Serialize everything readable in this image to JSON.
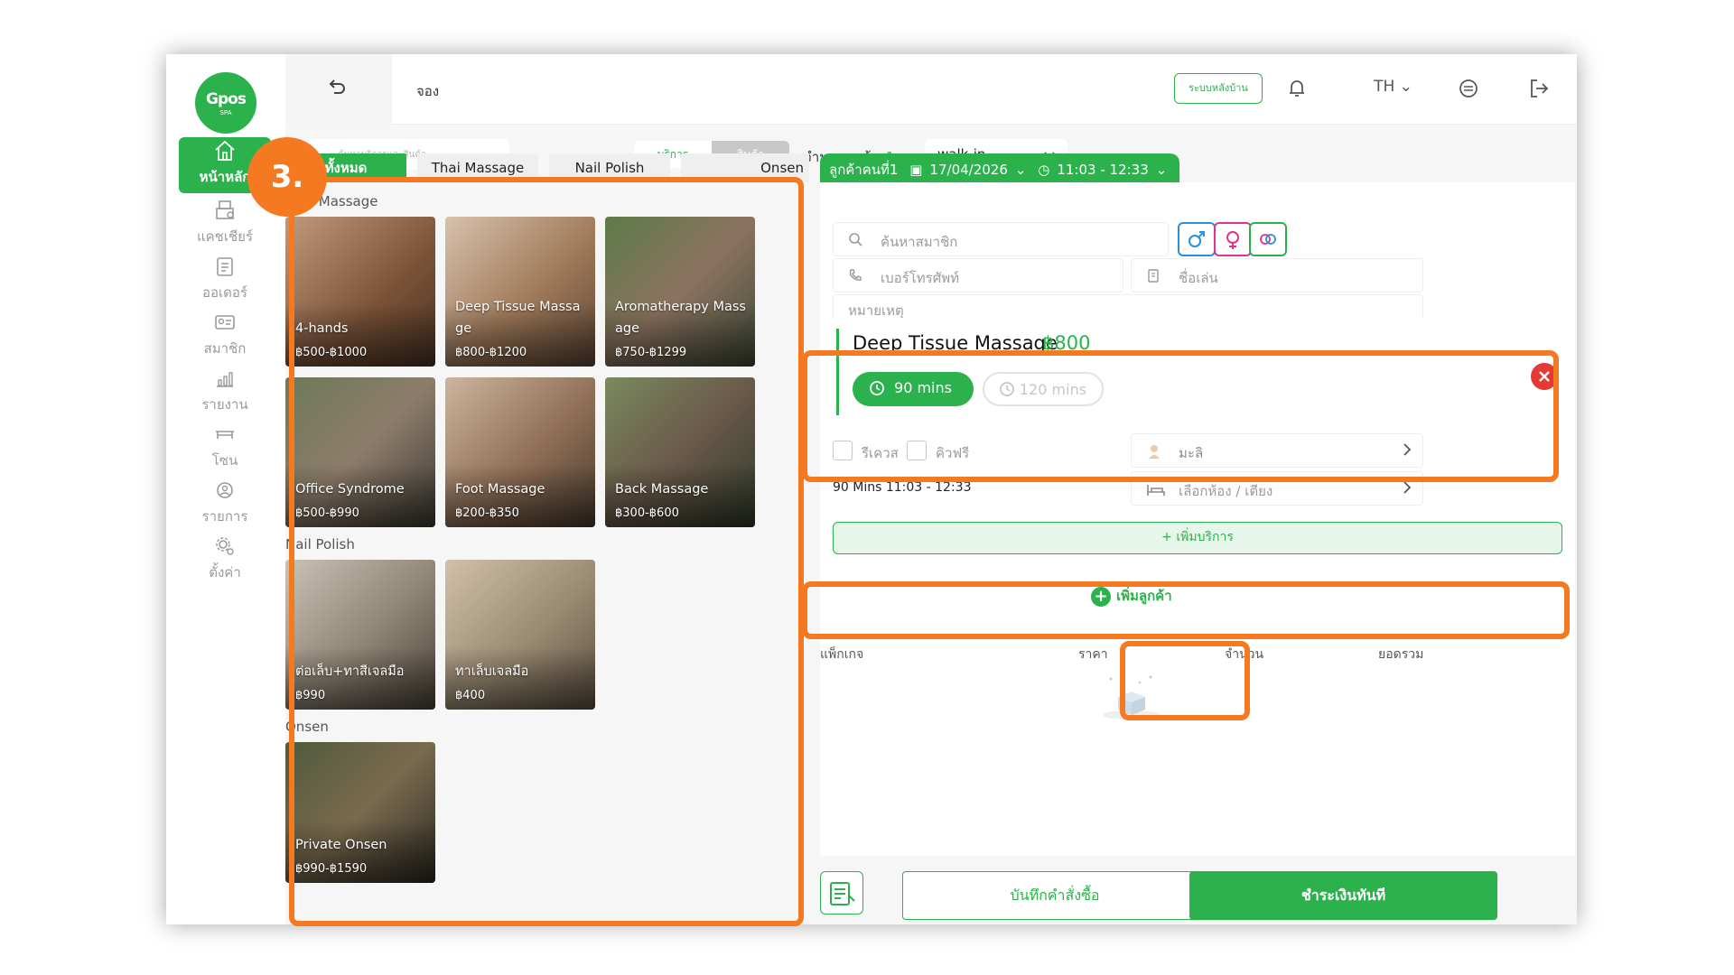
{
  "brand": {
    "logo_main": "Gpos",
    "logo_sub": "SPA",
    "accent": "#2bb24c",
    "annotation_color": "#f47920"
  },
  "sidebar": {
    "items": [
      {
        "label": "หน้าหลัก",
        "icon": "home-icon",
        "active": true
      },
      {
        "label": "แคชเชียร์",
        "icon": "cashier-icon"
      },
      {
        "label": "ออเดอร์",
        "icon": "clipboard-icon"
      },
      {
        "label": "สมาชิก",
        "icon": "member-card-icon"
      },
      {
        "label": "รายงาน",
        "icon": "report-chart-icon"
      },
      {
        "label": "โซน",
        "icon": "bed-zone-icon"
      },
      {
        "label": "รายการ",
        "icon": "spa-list-icon"
      },
      {
        "label": "ตั้งค่า",
        "icon": "settings-gear-icon"
      }
    ]
  },
  "topbar": {
    "page_title": "จอง",
    "backoffice_button": "ระบบหลังบ้าน",
    "language": "TH"
  },
  "toolbar": {
    "search_placeholder": "ค้นหาบริการและสินค้า",
    "mode_service": "บริการ",
    "mode_product": "สินค้า",
    "guest_count_label": "จำนวนลูกค้า",
    "guest_count_value": "1",
    "customer_type": "walk-in"
  },
  "annotation": {
    "step_label": "3."
  },
  "catalog": {
    "tabs": [
      "ทั้งหมด",
      "Thai Massage",
      "Nail Polish",
      "Onsen"
    ],
    "sections": [
      {
        "title": "Thai Massage",
        "items": [
          {
            "name": "4-hands",
            "price": "฿500-฿1000"
          },
          {
            "name": "Deep Tissue Massage",
            "name_line1": "Deep Tissue Massa",
            "name_line2": "ge",
            "price": "฿800-฿1200"
          },
          {
            "name": "Aromatherapy Massage",
            "name_line1": "Aromatherapy Mass",
            "name_line2": "age",
            "price": "฿750-฿1299"
          },
          {
            "name": "Office Syndrome",
            "price": "฿500-฿990"
          },
          {
            "name": "Foot Massage",
            "price": "฿200-฿350"
          },
          {
            "name": "Back Massage",
            "price": "฿300-฿600"
          }
        ]
      },
      {
        "title": "Nail Polish",
        "items": [
          {
            "name": "ต่อเล็บ+ทาสีเจลมือ",
            "price": "฿990"
          },
          {
            "name": "ทาเล็บเจลมือ",
            "price": "฿400"
          }
        ]
      },
      {
        "title": "Onsen",
        "items": [
          {
            "name": "Private Onsen",
            "price": "฿990-฿1590"
          }
        ]
      }
    ]
  },
  "booking": {
    "tab_label": "ลูกค้าคนที่1",
    "date": "17/04/2026",
    "time_range": "11:03 - 12:33",
    "member_search_placeholder": "ค้นหาสมาชิก",
    "phone_placeholder": "เบอร์โทรศัพท์",
    "nickname_placeholder": "ชื่อเล่น",
    "note_placeholder": "หมายเหตุ",
    "service": {
      "name": "Deep Tissue Massage",
      "price": "฿800",
      "durations": [
        "90 mins",
        "120 mins"
      ],
      "selected_duration": "90 mins"
    },
    "request_label": "รีเควส",
    "queue_free_label": "คิวฟรี",
    "therapist": "มะลิ",
    "summary": "90 Mins  11:03 - 12:33",
    "room_placeholder": "เลือกห้อง / เตียง",
    "add_service": "+ เพิ่มบริการ",
    "add_guest": "เพิ่มลูกค้า",
    "columns": [
      "แพ็กเกจ",
      "ราคา",
      "จำนวน",
      "ยอดรวม"
    ]
  },
  "actions": {
    "save_order": "บันทึกคำสั่งซื้อ",
    "pay_now": "ชำระเงินทันที"
  }
}
